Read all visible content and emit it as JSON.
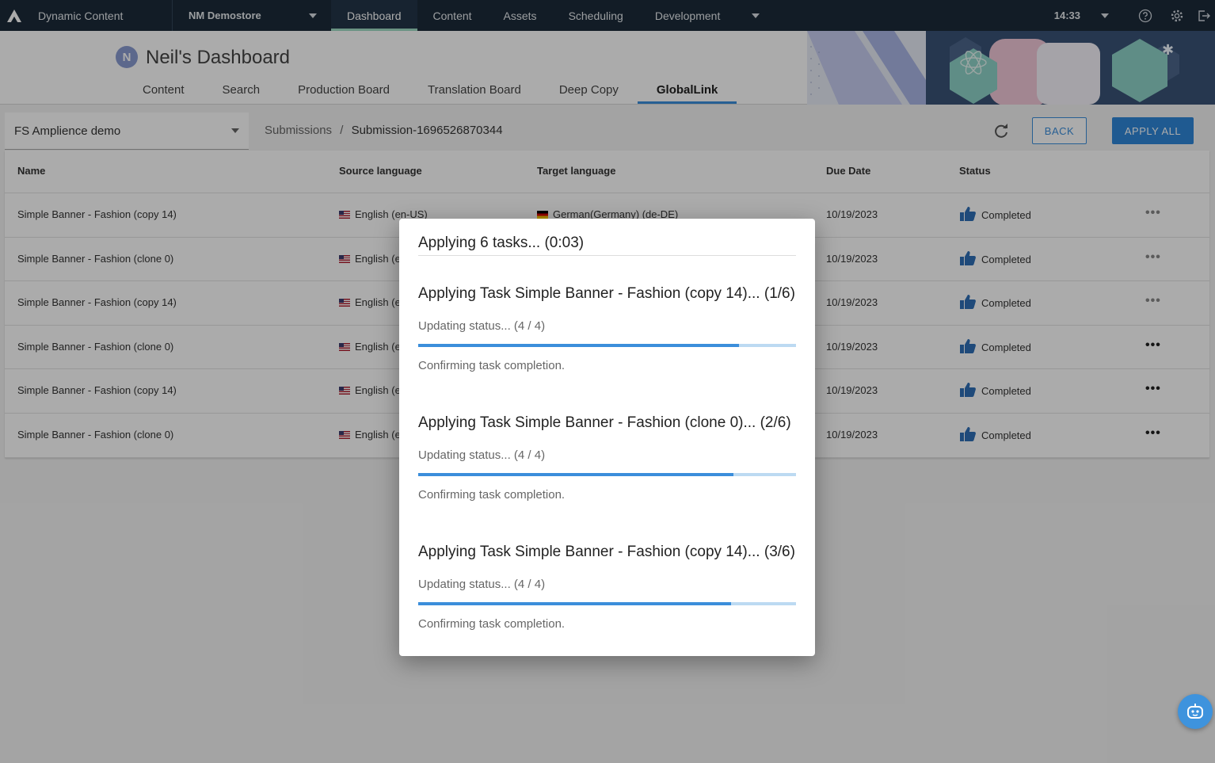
{
  "topnav": {
    "app_name": "Dynamic Content",
    "hub": "NM Demostore",
    "items": [
      "Dashboard",
      "Content",
      "Assets",
      "Scheduling",
      "Development"
    ],
    "active": "Dashboard",
    "clock": "14:33"
  },
  "header": {
    "avatar_initial": "N",
    "title": "Neil's Dashboard",
    "tabs": [
      "Content",
      "Search",
      "Production Board",
      "Translation Board",
      "Deep Copy",
      "GlobalLink"
    ],
    "active_tab": "GlobalLink"
  },
  "toolbar": {
    "hub_select": "FS Amplience demo",
    "breadcrumb_root": "Submissions",
    "breadcrumb_sep": "/",
    "breadcrumb_current": "Submission-1696526870344",
    "back_label": "BACK",
    "apply_all_label": "APPLY ALL"
  },
  "table": {
    "columns": [
      "Name",
      "Source language",
      "Target language",
      "Due Date",
      "Status"
    ],
    "rows": [
      {
        "name": "Simple Banner - Fashion (copy 14)",
        "source": "English (en-US)",
        "target": "German(Germany) (de-DE)",
        "due": "10/19/2023",
        "status": "Completed"
      },
      {
        "name": "Simple Banner - Fashion (clone 0)",
        "source": "English (e",
        "target": "",
        "due": "10/19/2023",
        "status": "Completed"
      },
      {
        "name": "Simple Banner - Fashion (copy 14)",
        "source": "English (e",
        "target": "",
        "due": "10/19/2023",
        "status": "Completed"
      },
      {
        "name": "Simple Banner - Fashion (clone 0)",
        "source": "English (e",
        "target": "",
        "due": "10/19/2023",
        "status": "Completed"
      },
      {
        "name": "Simple Banner - Fashion (copy 14)",
        "source": "English (e",
        "target": "",
        "due": "10/19/2023",
        "status": "Completed"
      },
      {
        "name": "Simple Banner - Fashion (clone 0)",
        "source": "English (e",
        "target": "",
        "due": "10/19/2023",
        "status": "Completed"
      }
    ]
  },
  "modal": {
    "title": "Applying 6 tasks... (0:03)",
    "tasks": [
      {
        "title": "Applying Task Simple Banner - Fashion (copy 14)... (1/6)",
        "status": "Updating status... (4 / 4)",
        "progress": 0.85,
        "confirm": "Confirming task completion."
      },
      {
        "title": "Applying Task Simple Banner - Fashion (clone 0)... (2/6)",
        "status": "Updating status... (4 / 4)",
        "progress": 0.835,
        "confirm": "Confirming task completion."
      },
      {
        "title": "Applying Task Simple Banner - Fashion (copy 14)... (3/6)",
        "status": "Updating status... (4 / 4)",
        "progress": 0.828,
        "confirm": "Confirming task completion."
      }
    ]
  },
  "colors": {
    "nav_bg": "#1c2b3a",
    "accent": "#3b8edb",
    "active_underline": "#9fdcc4"
  }
}
